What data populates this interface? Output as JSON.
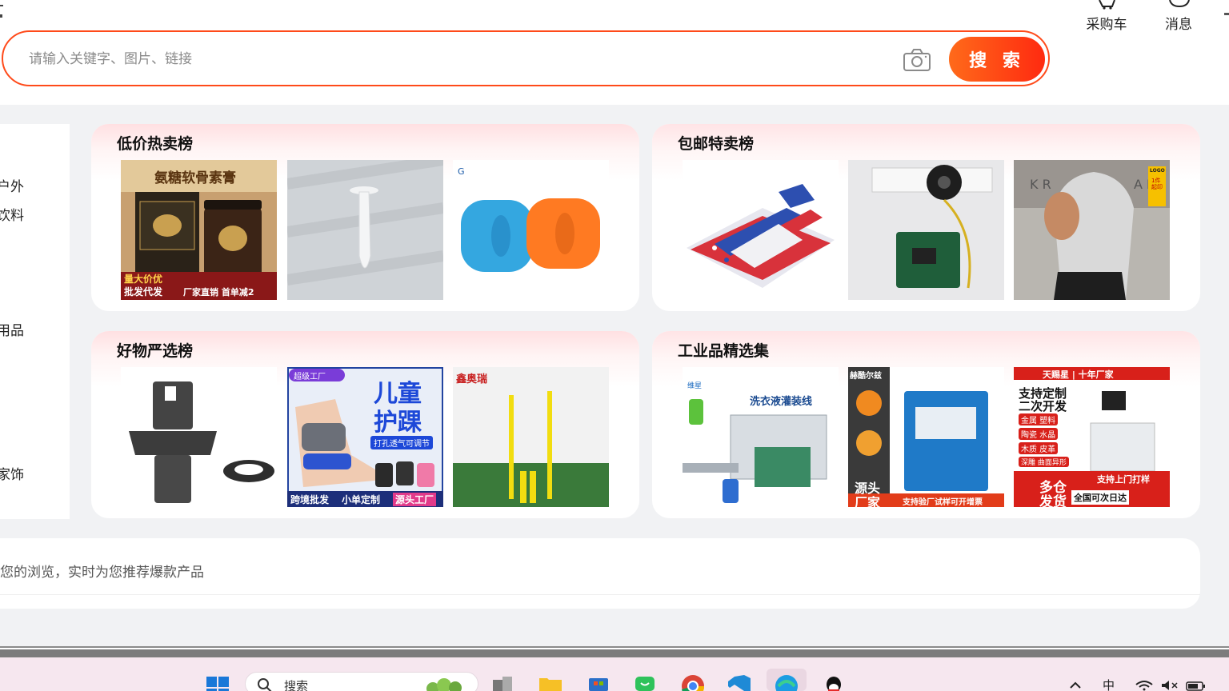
{
  "header": {
    "search_placeholder": "请输入关键字、图片、链接",
    "search_button": "搜 索",
    "cart_label": "采购车",
    "message_label": "消息"
  },
  "categories": [
    "户外",
    "饮料",
    "用品",
    "家饰"
  ],
  "cards": [
    {
      "title": "低价热卖榜",
      "products": [
        {
          "icon": "ointment-jar-image",
          "texts": [
            "氨糖软骨素膏",
            "量大价优",
            "批发代发",
            "厂家直销 首单减2"
          ]
        },
        {
          "icon": "plastic-cone-image",
          "texts": []
        },
        {
          "icon": "swim-armband-image",
          "texts": []
        }
      ]
    },
    {
      "title": "包邮特卖榜",
      "products": [
        {
          "icon": "playground-slide-image",
          "texts": []
        },
        {
          "icon": "circuit-board-speaker-image",
          "texts": []
        },
        {
          "icon": "tank-top-shirt-image",
          "texts": [
            "LOGO",
            "1件起印"
          ]
        }
      ]
    },
    {
      "title": "好物严选榜",
      "products": [
        {
          "icon": "plastic-valve-part-image",
          "texts": []
        },
        {
          "icon": "kids-ankle-brace-image",
          "texts": [
            "超级工厂",
            "儿童",
            "护踝",
            "打孔透气可调节",
            "跨境批发",
            "小单定制",
            "源头工厂"
          ]
        },
        {
          "icon": "yellow-posts-image",
          "texts": [
            "鑫奥瑞"
          ]
        }
      ]
    },
    {
      "title": "工业品精选集",
      "products": [
        {
          "icon": "filling-line-machine-image",
          "texts": [
            "洗衣液灌装线",
            "维星"
          ]
        },
        {
          "icon": "melting-furnace-image",
          "texts": [
            "赫酷尔兹",
            "源头",
            "厂家",
            "支持验厂试样可开增票"
          ]
        },
        {
          "icon": "laser-marking-machine-image",
          "texts": [
            "天赐星 | 十年厂家",
            "支持定制",
            "二次开发",
            "金属 塑料",
            "陶瓷 水晶",
            "木质 皮革",
            "深雕 曲面异形",
            "支持上门打样",
            "多仓",
            "发货",
            "全国可次日达"
          ]
        }
      ]
    }
  ],
  "recommend": {
    "text": "您的浏览，实时为您推荐爆款产品"
  },
  "taskbar": {
    "search_label": "搜索",
    "ime_label": "中"
  },
  "colors": {
    "accent": "#ff4a1a",
    "button_start": "#ff6a1a",
    "button_end": "#ff2a10"
  }
}
